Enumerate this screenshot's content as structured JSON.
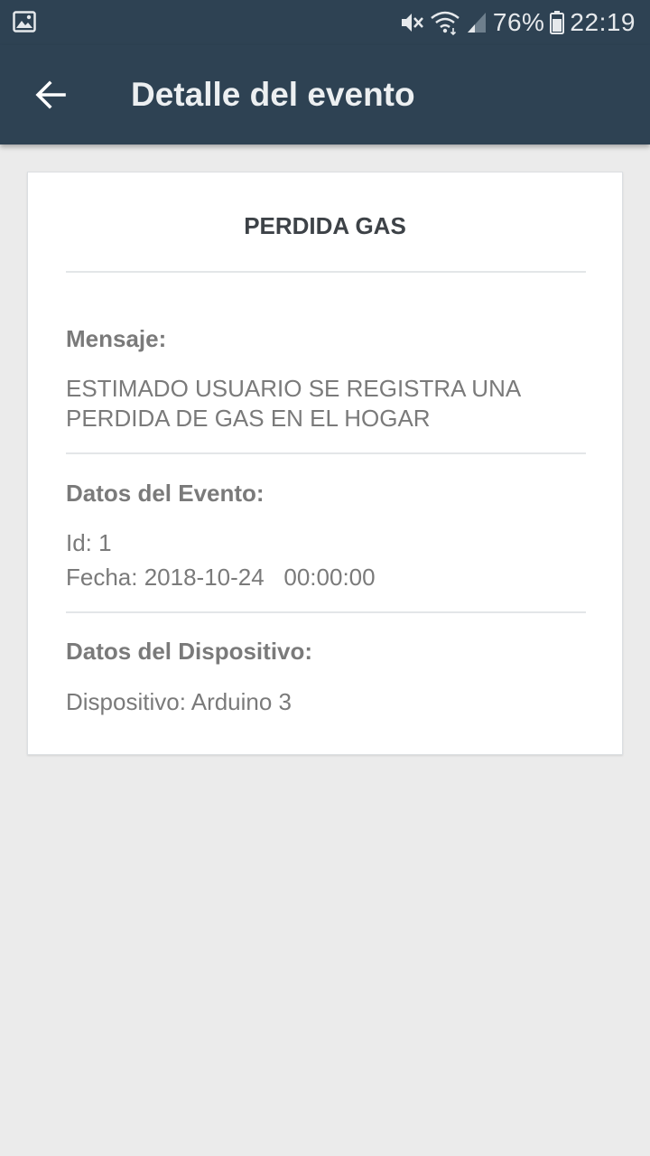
{
  "status_bar": {
    "battery_percent": "76%",
    "time": "22:19",
    "icons": [
      "gallery-icon",
      "mute-icon",
      "wifi-icon",
      "signal-icon",
      "battery-icon"
    ]
  },
  "app_bar": {
    "title": "Detalle del evento",
    "back_icon": "arrow-left-icon"
  },
  "card": {
    "title": "PERDIDA GAS",
    "message": {
      "label": "Mensaje:",
      "text": "ESTIMADO USUARIO SE REGISTRA UNA PERDIDA DE GAS EN EL HOGAR"
    },
    "event": {
      "label": "Datos del Evento:",
      "id_text": "Id: 1",
      "date_text": "Fecha: 2018-10-24   00:00:00"
    },
    "device": {
      "label": "Datos del Dispositivo:",
      "device_text": "Dispositivo: Arduino 3"
    }
  },
  "colors": {
    "app_bar": "#2e4253",
    "background": "#ebebeb",
    "card": "#ffffff",
    "body_text": "#7a7a7a",
    "title_text": "#3d4247"
  }
}
